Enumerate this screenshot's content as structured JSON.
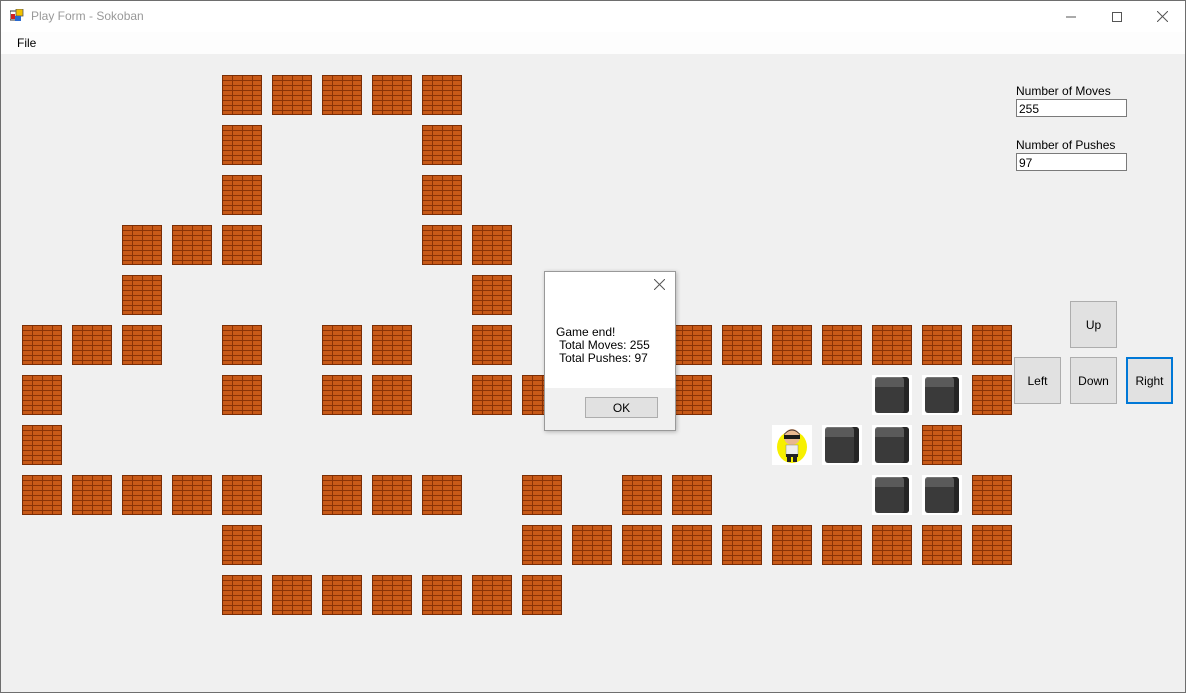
{
  "window": {
    "title": "Play Form - Sokoban",
    "icon": "app-icon"
  },
  "menu": {
    "file_label": "File"
  },
  "moves": {
    "label": "Number of Moves",
    "value": "255"
  },
  "pushes": {
    "label": "Number of Pushes",
    "value": "97"
  },
  "controls": {
    "up": "Up",
    "left": "Left",
    "down": "Down",
    "right": "Right",
    "focused": "Right"
  },
  "dialog": {
    "message": "Game end!\n Total Moves: 255\n Total Pushes: 97",
    "ok_label": "OK"
  },
  "colors": {
    "brick": "#c85a18",
    "mortar": "#8a3306",
    "box": "#3a3a3a",
    "focus": "#0078d7"
  },
  "grid": {
    "legend": {
      "W": "wall",
      "B": "box",
      "P": "player",
      ".": "empty"
    },
    "rows": [
      "....WWWWW...........",
      "....W...W...........",
      "....W...W...........",
      "..WWW...WW..........",
      "..W......W..........",
      "WWW.W.WW.W...WWWWWWW",
      "W...W.WW.WW..W...BBW",
      "W..............PBBW.",
      "WWWWW.WWW.W.WW...BBW",
      "....W.....WWWWWWWWWW",
      "....WWWWWWW........."
    ]
  }
}
